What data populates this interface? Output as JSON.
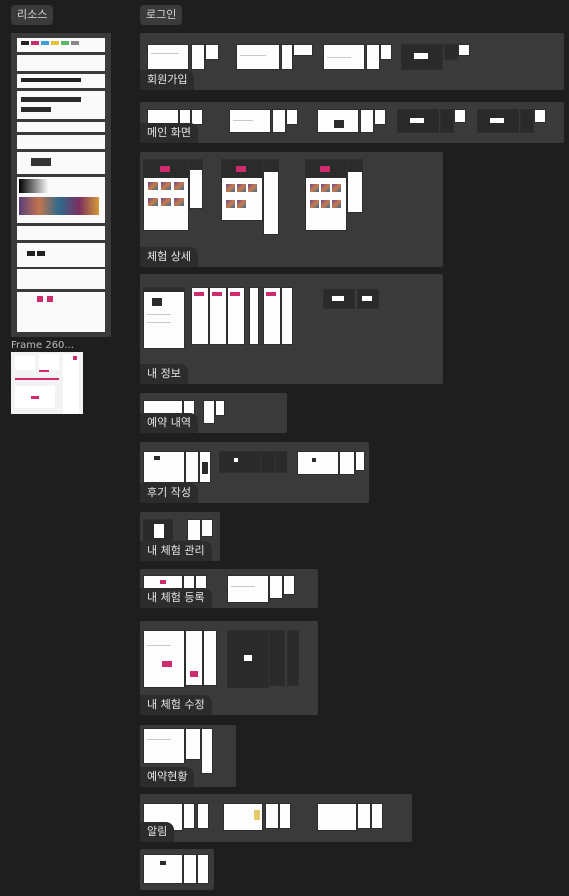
{
  "left_column": {
    "title": "리소스",
    "frame_label": "Frame 260..."
  },
  "main_column": {
    "title": "로그인"
  },
  "sections": [
    {
      "id": "signup",
      "title": "회원가입"
    },
    {
      "id": "main-screen",
      "title": "메인 화면"
    },
    {
      "id": "experience-detail",
      "title": "체험 상세"
    },
    {
      "id": "my-info",
      "title": "내 정보"
    },
    {
      "id": "reservations",
      "title": "예약 내역"
    },
    {
      "id": "review",
      "title": "후기 작성"
    },
    {
      "id": "my-experience-manage",
      "title": "내 체험 관리"
    },
    {
      "id": "my-experience-register",
      "title": "내 체험 등록"
    },
    {
      "id": "my-experience-edit",
      "title": "내 체험 수정"
    },
    {
      "id": "reservation-status",
      "title": "예약현황"
    },
    {
      "id": "notification",
      "title": "알림"
    }
  ],
  "colors": {
    "canvas": "#1e1e1e",
    "section": "#3a3a3a",
    "accent": "#cf2a6e"
  }
}
